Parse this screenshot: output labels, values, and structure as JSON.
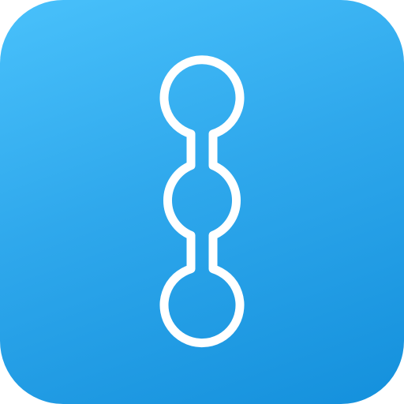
{
  "app_icon": {
    "icon": "three-connected-circles-icon",
    "colors": {
      "gradient_top": "#49c1fb",
      "gradient_mid": "#2fa8ec",
      "gradient_bottom": "#1490dc",
      "glyph_stroke": "#ffffff"
    }
  }
}
